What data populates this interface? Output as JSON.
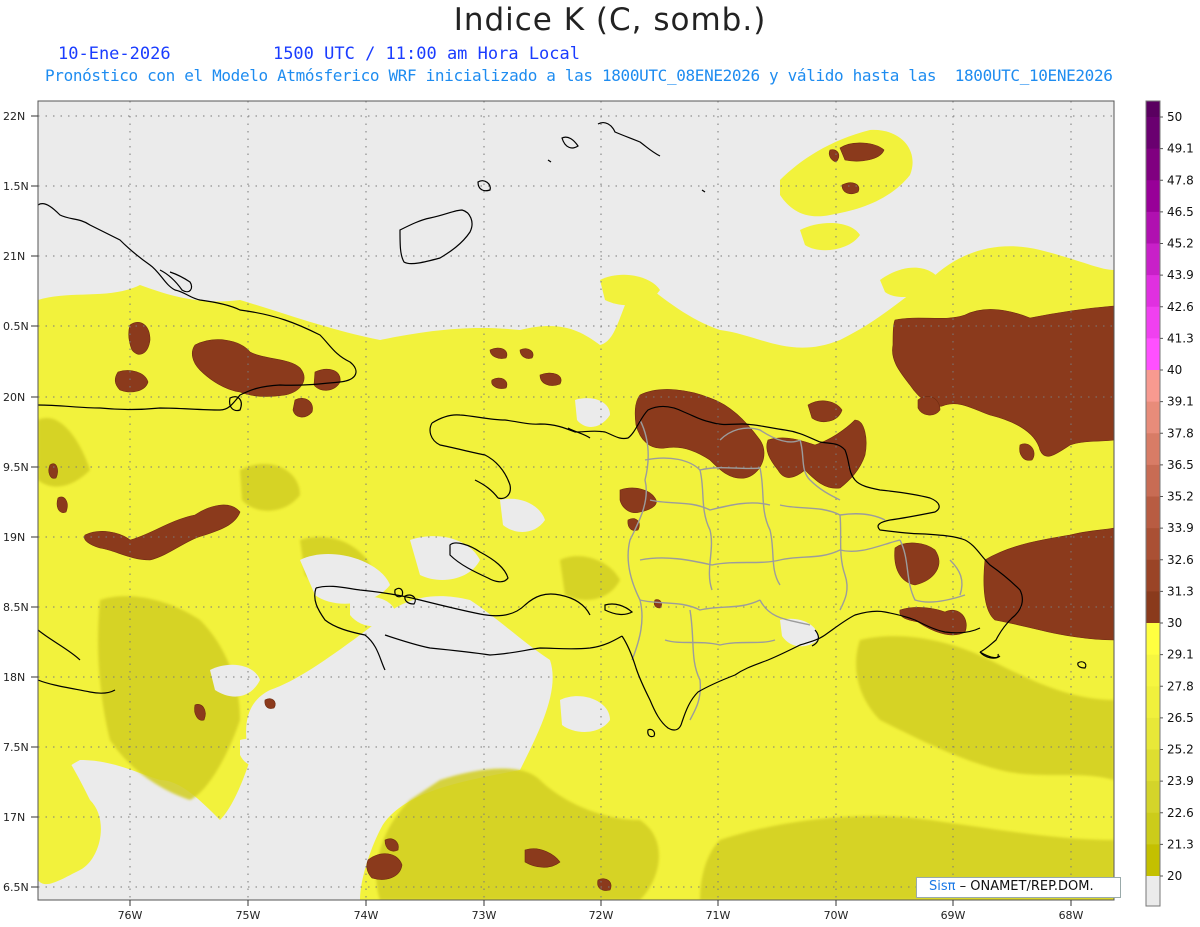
{
  "title": "Indice K (C, somb.)",
  "subtitle_date": "10-Ene-2026",
  "subtitle_time": "1500 UTC / 11:00 am Hora Local",
  "description": "Pronóstico con el Modelo Atmósferico WRF inicializado a las 1800UTC_08ENE2026 y válido hasta las  1800UTC_10ENE2026",
  "credit": {
    "brand": "Sisπ",
    "org": "– ONAMET/REP.DOM."
  },
  "lat_labels": [
    "22N",
    "1.5N",
    "21N",
    "0.5N",
    "20N",
    "9.5N",
    "19N",
    "8.5N",
    "18N",
    "7.5N",
    "17N",
    "6.5N"
  ],
  "lon_labels": [
    "76W",
    "75W",
    "74W",
    "73W",
    "72W",
    "71W",
    "70W",
    "69W",
    "68W"
  ],
  "colorbar": {
    "levels": [
      "20",
      "21.3",
      "22.6",
      "23.9",
      "25.2",
      "26.5",
      "27.8",
      "29.1",
      "30",
      "31.3",
      "32.6",
      "33.9",
      "35.2",
      "36.5",
      "37.8",
      "39.1",
      "40",
      "41.3",
      "42.6",
      "43.9",
      "45.2",
      "46.5",
      "47.8",
      "49.1",
      "50"
    ],
    "colors": [
      "#c4c000",
      "#cccc1a",
      "#d4d42a",
      "#dede30",
      "#e8e838",
      "#f0f03c",
      "#f6f640",
      "#ffff40",
      "#8a3a1c",
      "#9a4426",
      "#aa5034",
      "#b85c42",
      "#c86c54",
      "#d87c66",
      "#e88c7a",
      "#f89a90",
      "#ff50ff",
      "#f040f0",
      "#e030e0",
      "#c820c8",
      "#b010b0",
      "#980098",
      "#800080",
      "#6a0070"
    ]
  },
  "colors": {
    "background": "#ebebeb",
    "coast": "#000000",
    "provinces": "#a0a0a0",
    "yellow": "#f2f23c",
    "brown": "#8b3a1c"
  }
}
